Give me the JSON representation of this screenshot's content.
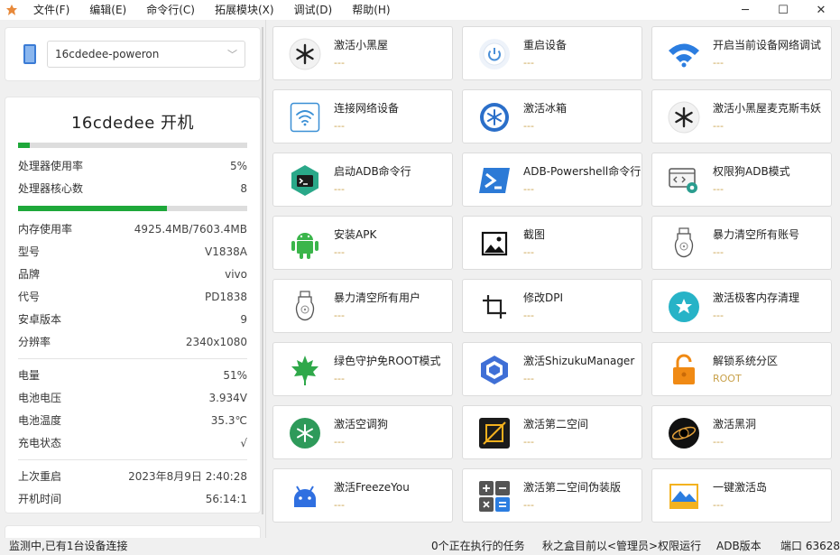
{
  "menu": [
    "文件(F)",
    "编辑(E)",
    "命令行(C)",
    "拓展模块(X)",
    "调试(D)",
    "帮助(H)"
  ],
  "device_select": {
    "value": "16cdedee-poweron"
  },
  "device": {
    "title": "16cdedee   开机",
    "cpu_bar_percent": 5,
    "core_bar_percent": 65,
    "rows1": [
      {
        "k": "处理器使用率",
        "v": "5%"
      },
      {
        "k": "处理器核心数",
        "v": "8"
      }
    ],
    "rows2": [
      {
        "k": "内存使用率",
        "v": "4925.4MB/7603.4MB"
      },
      {
        "k": "型号",
        "v": "V1838A"
      },
      {
        "k": "品牌",
        "v": "vivo"
      },
      {
        "k": "代号",
        "v": "PD1838"
      },
      {
        "k": "安卓版本",
        "v": "9"
      },
      {
        "k": "分辨率",
        "v": "2340x1080"
      }
    ],
    "rows3": [
      {
        "k": "电量",
        "v": "51%"
      },
      {
        "k": "电池电压",
        "v": "3.934V"
      },
      {
        "k": "电池温度",
        "v": "35.3℃"
      },
      {
        "k": "充电状态",
        "v": "√"
      }
    ],
    "rows4": [
      {
        "k": "上次重启",
        "v": "2023年8月9日 2:40:28"
      },
      {
        "k": "开机时间",
        "v": "56:14:1"
      }
    ]
  },
  "tiles": [
    {
      "title": "激活小黑屋",
      "sub": "---",
      "icon": "snowflake-dark-icon"
    },
    {
      "title": "重启设备",
      "sub": "---",
      "icon": "power-icon"
    },
    {
      "title": "开启当前设备网络调试",
      "sub": "---",
      "icon": "wifi-icon"
    },
    {
      "title": "连接网络设备",
      "sub": "---",
      "icon": "wifi-outline-icon"
    },
    {
      "title": "激活冰箱",
      "sub": "---",
      "icon": "ice-box-icon"
    },
    {
      "title": "激活小黑屋麦克斯韦妖",
      "sub": "---",
      "icon": "snowflake-dark-icon"
    },
    {
      "title": "启动ADB命令行",
      "sub": "---",
      "icon": "terminal-icon"
    },
    {
      "title": "ADB-Powershell命令行",
      "sub": "---",
      "icon": "powershell-icon"
    },
    {
      "title": "权限狗ADB模式",
      "sub": "---",
      "icon": "code-gear-icon"
    },
    {
      "title": "安装APK",
      "sub": "---",
      "icon": "android-icon"
    },
    {
      "title": "截图",
      "sub": "---",
      "icon": "image-icon"
    },
    {
      "title": "暴力清空所有账号",
      "sub": "---",
      "icon": "bomb-icon"
    },
    {
      "title": "暴力清空所有用户",
      "sub": "---",
      "icon": "bomb-icon"
    },
    {
      "title": "修改DPI",
      "sub": "---",
      "icon": "crop-icon"
    },
    {
      "title": "激活极客内存清理",
      "sub": "---",
      "icon": "star-badge-icon"
    },
    {
      "title": "绿色守护免ROOT模式",
      "sub": "---",
      "icon": "maple-leaf-icon"
    },
    {
      "title": "激活ShizukuManager",
      "sub": "---",
      "icon": "shizuku-icon"
    },
    {
      "title": "解锁系统分区",
      "sub": "ROOT",
      "icon": "unlock-icon"
    },
    {
      "title": "激活空调狗",
      "sub": "---",
      "icon": "snowflake-green-icon"
    },
    {
      "title": "激活第二空间",
      "sub": "---",
      "icon": "frame-icon"
    },
    {
      "title": "激活黑洞",
      "sub": "---",
      "icon": "black-hole-icon"
    },
    {
      "title": "激活FreezeYou",
      "sub": "---",
      "icon": "freezeyou-icon"
    },
    {
      "title": "激活第二空间伪装版",
      "sub": "---",
      "icon": "calculator-icon"
    },
    {
      "title": "一键激活岛",
      "sub": "---",
      "icon": "island-icon"
    }
  ],
  "status": {
    "left": "监测中,已有1台设备连接",
    "tasks": "0个正在执行的任务",
    "perm": "秋之盒目前以<管理员>权限运行",
    "adb": "ADB版本",
    "port": "端口 63628"
  },
  "colors": {
    "accent": "#1ea83a",
    "sub_text": "#c8a14a",
    "border": "#dcdcdc"
  }
}
